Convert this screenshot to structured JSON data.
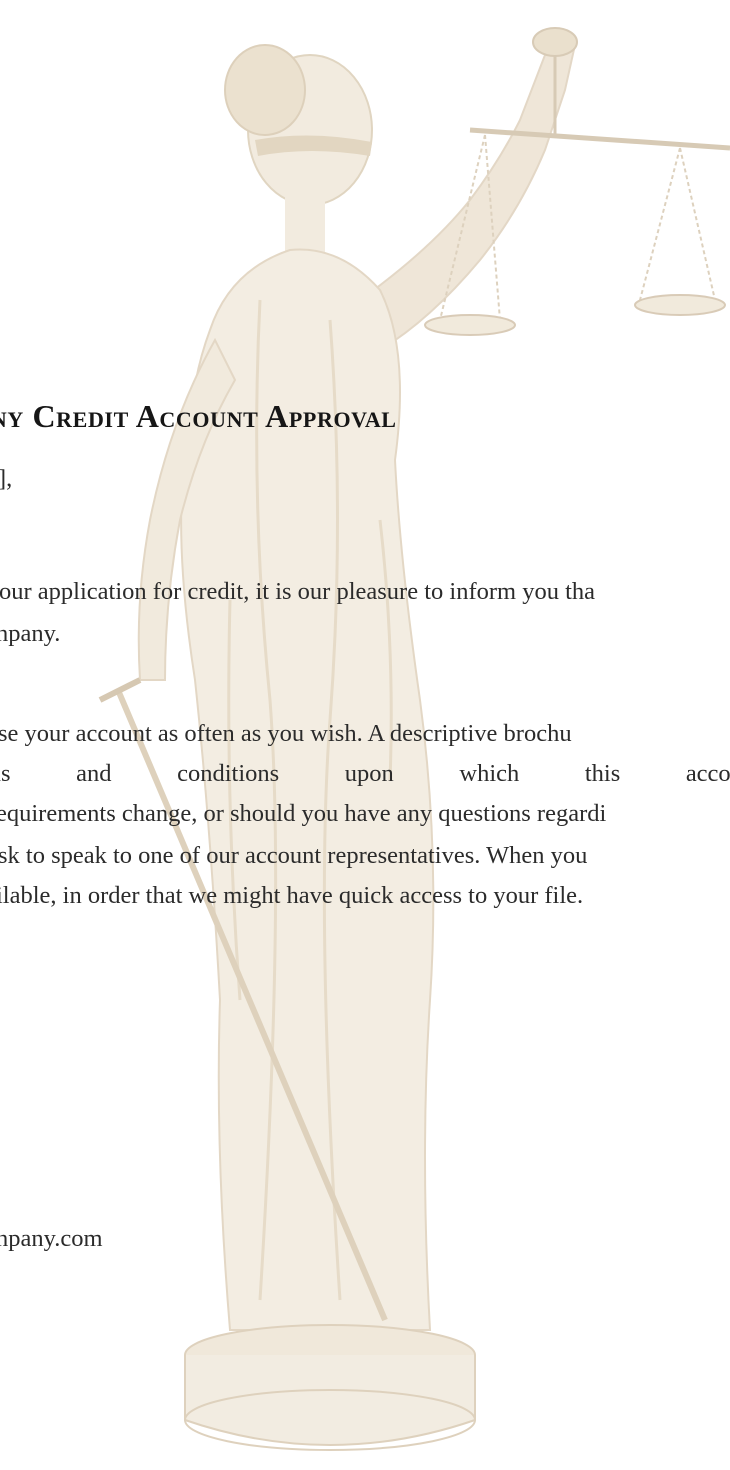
{
  "letter": {
    "title": "pany Credit Account Approval",
    "salutation": "],",
    "paragraph1": [
      "our application for credit, it is our pleasure to inform you tha",
      "npany."
    ],
    "paragraph2": {
      "line1": "se your account as often as you wish. A descriptive brochu",
      "line2_words": [
        "ms",
        "and",
        "conditions",
        "upon",
        "which",
        "this",
        "account"
      ],
      "line3": "equirements change, or should you have any questions regardi",
      "line4": "sk to speak to one of our account representatives. When you",
      "line5": "ilable, in order that we might have quick access to your file."
    },
    "contact": "npany.com"
  },
  "watermark": {
    "subject": "Lady Justice statue holding scales and sword",
    "tint": "#d9c9ae"
  }
}
